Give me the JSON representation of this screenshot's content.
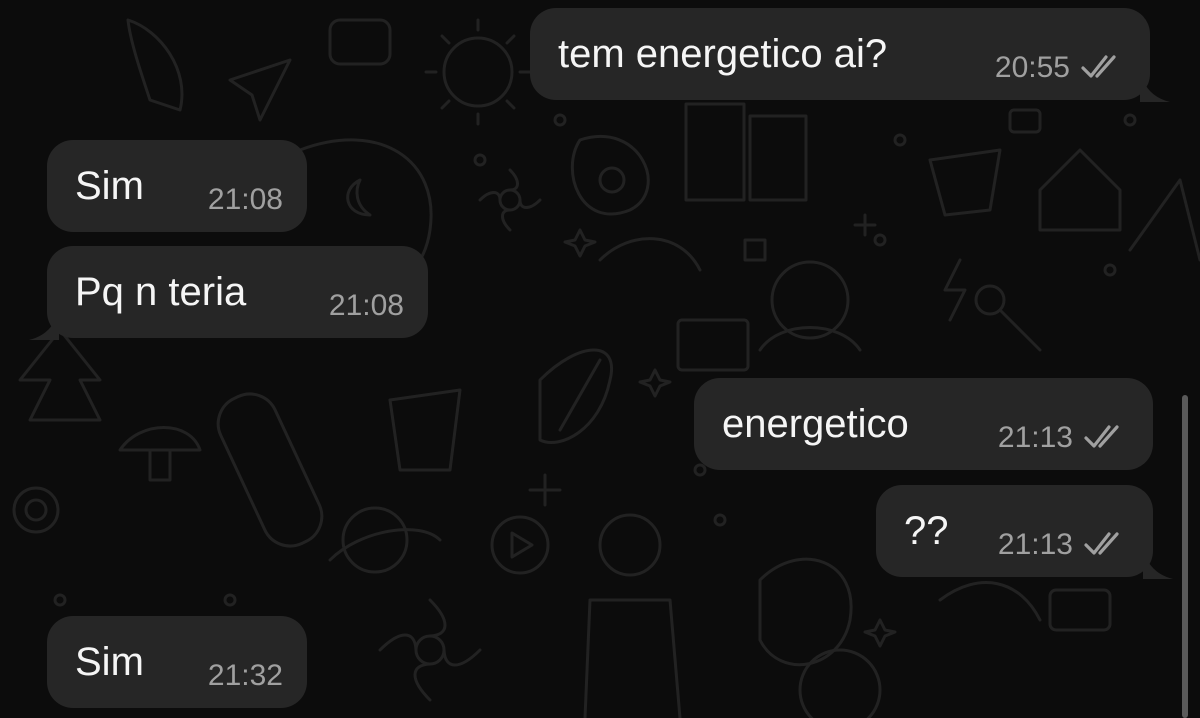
{
  "messages": [
    {
      "direction": "out",
      "text": "tem energetico ai?",
      "time": "20:55",
      "status_icon": "double-check-icon"
    },
    {
      "direction": "in",
      "text": "Sim",
      "time": "21:08"
    },
    {
      "direction": "in",
      "text": "Pq n teria",
      "time": "21:08"
    },
    {
      "direction": "out",
      "text": "energetico",
      "time": "21:13",
      "status_icon": "double-check-icon"
    },
    {
      "direction": "out",
      "text": "??",
      "time": "21:13",
      "status_icon": "double-check-icon"
    },
    {
      "direction": "in",
      "text": "Sim",
      "time": "21:32"
    }
  ],
  "colors": {
    "background": "#0c0c0c",
    "bubble": "#262626",
    "text": "#f5f5f5",
    "time": "#a0a0a0",
    "doodle": "#1f1f1f"
  }
}
